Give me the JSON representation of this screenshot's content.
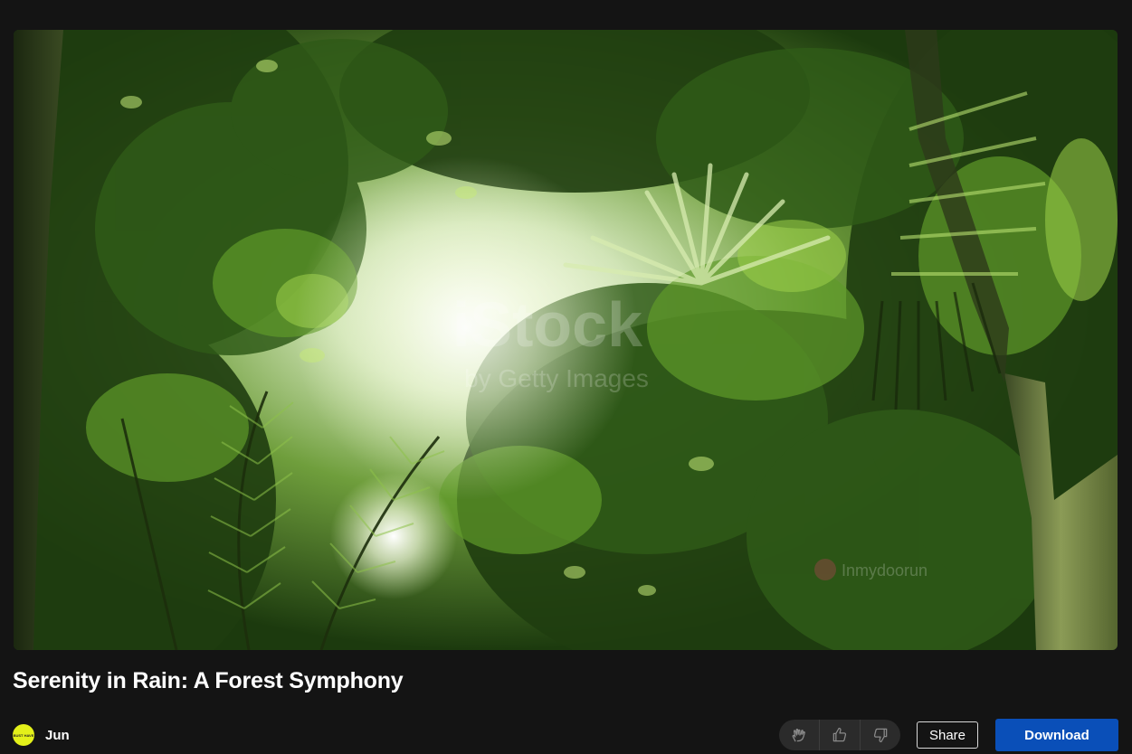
{
  "media": {
    "alt": "Serenity in Rain: A Forest Symphony",
    "watermark_text": "iStock",
    "watermark_sub": "by Getty Images",
    "credit_text": "Inmydoorun"
  },
  "title": "Serenity in Rain: A Forest Symphony",
  "author": {
    "name": "Jun",
    "avatar_text": "BUST HAVE",
    "avatar_color": "#e3f01a"
  },
  "actions": {
    "reactions": [
      "clap-icon",
      "thumbs-up-icon",
      "thumbs-down-icon"
    ],
    "share_label": "Share",
    "download_label": "Download",
    "download_color": "#0a4fb8"
  }
}
